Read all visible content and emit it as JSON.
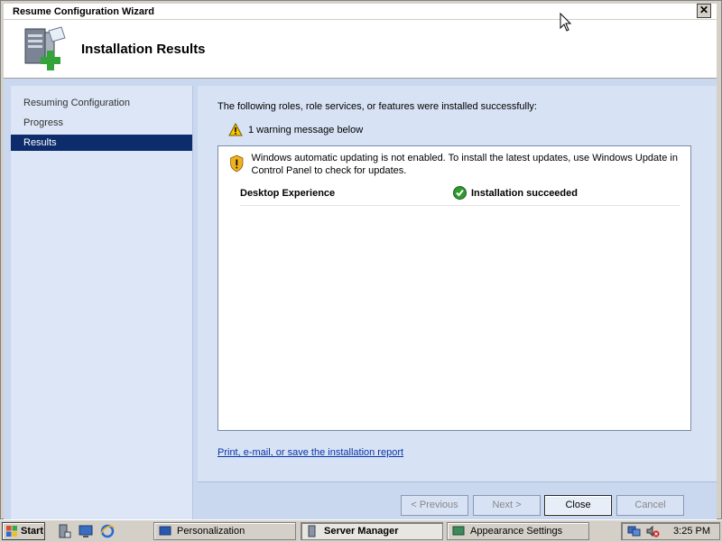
{
  "window": {
    "title": "Resume Configuration Wizard",
    "close_label": "✕"
  },
  "header": {
    "title": "Installation Results",
    "icon": "server-add-icon"
  },
  "sidebar": {
    "items": [
      {
        "label": "Resuming Configuration",
        "active": false
      },
      {
        "label": "Progress",
        "active": false
      },
      {
        "label": "Results",
        "active": true
      }
    ]
  },
  "main": {
    "intro": "The following roles, role services, or features were installed successfully:",
    "warning_summary": "1 warning message below",
    "warning_message": "Windows automatic updating is not enabled. To install the latest updates, use Windows Update in Control Panel to check for updates.",
    "feature_name": "Desktop Experience",
    "feature_status": "Installation succeeded",
    "report_link": "Print, e-mail, or save the installation report"
  },
  "buttons": {
    "previous": "< Previous",
    "next": "Next >",
    "close": "Close",
    "cancel": "Cancel"
  },
  "taskbar": {
    "start": "Start",
    "tasks": [
      {
        "label": "Personalization",
        "active": false
      },
      {
        "label": "Server Manager",
        "active": true
      },
      {
        "label": "Appearance Settings",
        "active": false
      }
    ],
    "clock": "3:25 PM"
  },
  "colors": {
    "selection": "#0c2c6c",
    "panel": "#c9d7ef",
    "link": "#0a35a8"
  }
}
